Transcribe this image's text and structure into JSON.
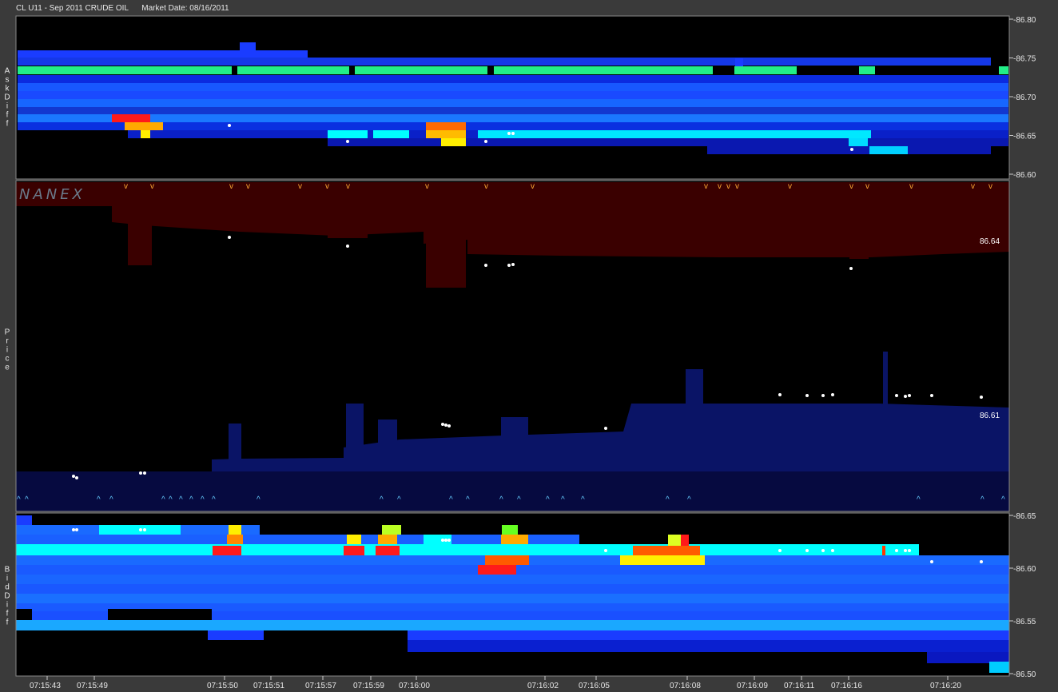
{
  "header": {
    "title": "CL U11 - Sep 2011 CRUDE OIL      Market Date: 08/16/2011"
  },
  "watermark": "NANEX",
  "colors": {
    "background": "#000000",
    "frame": "#3a3a3a",
    "ask_level": "#0a2aff",
    "bid_level": "#1a6aff",
    "cyan": "#00ffff",
    "green": "#22ee88",
    "orange": "#ff7700",
    "yellow": "#ffee00",
    "red": "#ff1a1a",
    "ask_band": "#3a0000",
    "bid_band": "#0a1466"
  },
  "chart_data": [
    {
      "type": "heatmap",
      "name": "AskDiff",
      "ylabel": "AskDiff",
      "yticks": [
        "86.80",
        "86.75",
        "86.70",
        "86.65",
        "86.60"
      ],
      "ylim": [
        86.6,
        86.8
      ]
    },
    {
      "type": "line",
      "name": "Price",
      "ylabel": "Price",
      "price_labels": [
        "86.64",
        "86.61"
      ],
      "ask_markers": "^",
      "bid_markers": "^"
    },
    {
      "type": "heatmap",
      "name": "BidDiff",
      "ylabel": "BidDiff",
      "yticks": [
        "86.65",
        "86.60",
        "86.55",
        "86.50"
      ],
      "ylim": [
        86.5,
        86.65
      ],
      "xticks": [
        "07:15:43",
        "07:15:49",
        "07:15:50",
        "07:15:51",
        "07:15:57",
        "07:15:59",
        "07:16:00",
        "07:16:02",
        "07:16:05",
        "07:16:08",
        "07:16:09",
        "07:16:11",
        "07:16:16",
        "07:16:20"
      ]
    }
  ]
}
